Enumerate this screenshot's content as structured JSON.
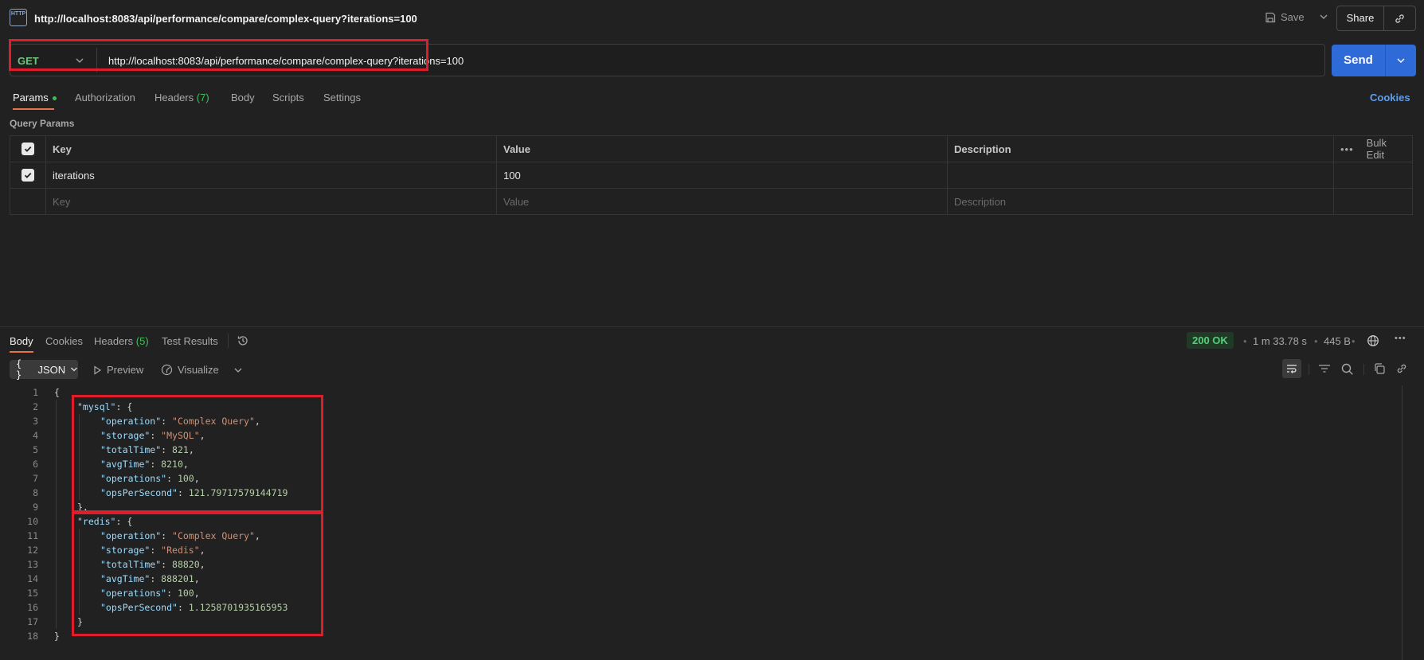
{
  "header": {
    "app_icon_text": "HTTP",
    "title": "http://localhost:8083/api/performance/compare/complex-query?iterations=100",
    "save_label": "Save",
    "share_label": "Share"
  },
  "request": {
    "method": "GET",
    "url": "http://localhost:8083/api/performance/compare/complex-query?iterations=100",
    "send_label": "Send"
  },
  "request_tabs": {
    "params": "Params",
    "authorization": "Authorization",
    "headers": "Headers",
    "headers_count": "(7)",
    "body": "Body",
    "scripts": "Scripts",
    "settings": "Settings",
    "cookies": "Cookies"
  },
  "query_params": {
    "section_label": "Query Params",
    "columns": {
      "key": "Key",
      "value": "Value",
      "description": "Description",
      "bulk_edit": "Bulk Edit"
    },
    "rows": [
      {
        "key": "iterations",
        "value": "100",
        "description": "",
        "checked": true
      }
    ],
    "placeholders": {
      "key": "Key",
      "value": "Value",
      "description": "Description"
    }
  },
  "response_tabs": {
    "body": "Body",
    "cookies": "Cookies",
    "headers": "Headers",
    "headers_count": "(5)",
    "test_results": "Test Results"
  },
  "response_meta": {
    "status": "200 OK",
    "time": "1 m 33.78 s",
    "size": "445 B"
  },
  "format_bar": {
    "format": "JSON",
    "format_icon": "{ }",
    "preview": "Preview",
    "visualize": "Visualize"
  },
  "colors": {
    "send_button": "#2f6ad9",
    "highlight_box": "#e01e2b",
    "status_ok": "#54d07a",
    "active_tab_underline": "#e8734a"
  },
  "response_body": {
    "line_numbers": [
      "1",
      "2",
      "3",
      "4",
      "5",
      "6",
      "7",
      "8",
      "9",
      "10",
      "11",
      "12",
      "13",
      "14",
      "15",
      "16",
      "17",
      "18"
    ],
    "lines": [
      [
        {
          "t": "p",
          "v": "{"
        }
      ],
      [
        {
          "t": "k",
          "v": "\"mysql\""
        },
        {
          "t": "p",
          "v": ": {"
        }
      ],
      [
        {
          "t": "k",
          "v": "\"operation\""
        },
        {
          "t": "p",
          "v": ": "
        },
        {
          "t": "s",
          "v": "\"Complex Query\""
        },
        {
          "t": "p",
          "v": ","
        }
      ],
      [
        {
          "t": "k",
          "v": "\"storage\""
        },
        {
          "t": "p",
          "v": ": "
        },
        {
          "t": "s",
          "v": "\"MySQL\""
        },
        {
          "t": "p",
          "v": ","
        }
      ],
      [
        {
          "t": "k",
          "v": "\"totalTime\""
        },
        {
          "t": "p",
          "v": ": "
        },
        {
          "t": "n",
          "v": "821"
        },
        {
          "t": "p",
          "v": ","
        }
      ],
      [
        {
          "t": "k",
          "v": "\"avgTime\""
        },
        {
          "t": "p",
          "v": ": "
        },
        {
          "t": "n",
          "v": "8210"
        },
        {
          "t": "p",
          "v": ","
        }
      ],
      [
        {
          "t": "k",
          "v": "\"operations\""
        },
        {
          "t": "p",
          "v": ": "
        },
        {
          "t": "n",
          "v": "100"
        },
        {
          "t": "p",
          "v": ","
        }
      ],
      [
        {
          "t": "k",
          "v": "\"opsPerSecond\""
        },
        {
          "t": "p",
          "v": ": "
        },
        {
          "t": "n",
          "v": "121.79717579144719"
        }
      ],
      [
        {
          "t": "p",
          "v": "},"
        }
      ],
      [
        {
          "t": "k",
          "v": "\"redis\""
        },
        {
          "t": "p",
          "v": ": {"
        }
      ],
      [
        {
          "t": "k",
          "v": "\"operation\""
        },
        {
          "t": "p",
          "v": ": "
        },
        {
          "t": "s",
          "v": "\"Complex Query\""
        },
        {
          "t": "p",
          "v": ","
        }
      ],
      [
        {
          "t": "k",
          "v": "\"storage\""
        },
        {
          "t": "p",
          "v": ": "
        },
        {
          "t": "s",
          "v": "\"Redis\""
        },
        {
          "t": "p",
          "v": ","
        }
      ],
      [
        {
          "t": "k",
          "v": "\"totalTime\""
        },
        {
          "t": "p",
          "v": ": "
        },
        {
          "t": "n",
          "v": "88820"
        },
        {
          "t": "p",
          "v": ","
        }
      ],
      [
        {
          "t": "k",
          "v": "\"avgTime\""
        },
        {
          "t": "p",
          "v": ": "
        },
        {
          "t": "n",
          "v": "888201"
        },
        {
          "t": "p",
          "v": ","
        }
      ],
      [
        {
          "t": "k",
          "v": "\"operations\""
        },
        {
          "t": "p",
          "v": ": "
        },
        {
          "t": "n",
          "v": "100"
        },
        {
          "t": "p",
          "v": ","
        }
      ],
      [
        {
          "t": "k",
          "v": "\"opsPerSecond\""
        },
        {
          "t": "p",
          "v": ": "
        },
        {
          "t": "n",
          "v": "1.1258701935165953"
        }
      ],
      [
        {
          "t": "p",
          "v": "}"
        }
      ],
      [
        {
          "t": "p",
          "v": "}"
        }
      ]
    ]
  }
}
